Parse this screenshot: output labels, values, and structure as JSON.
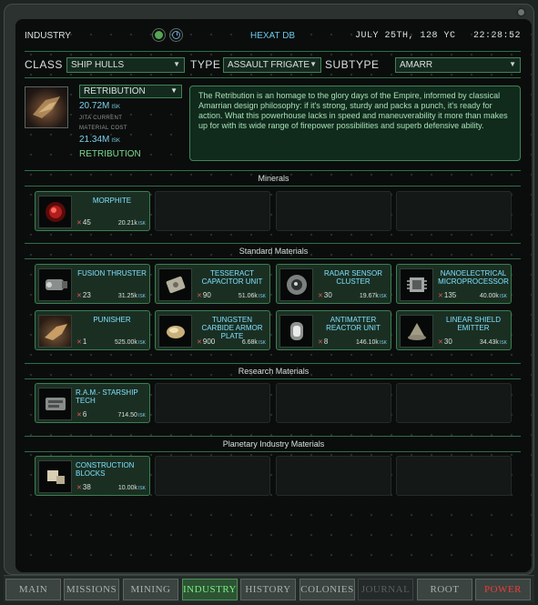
{
  "topbar": {
    "title": "INDUSTRY",
    "center": "HEXAT DB",
    "datetime": "JULY 25TH, 128 YC   22:28:52"
  },
  "filters": {
    "class_label": "CLASS",
    "class_value": "SHIP HULLS",
    "type_label": "TYPE",
    "type_value": "ASSAULT FRIGATE",
    "subtype_label": "SUBTYPE",
    "subtype_value": "AMARR"
  },
  "product": {
    "select_value": "RETRIBUTION",
    "jita_value": "20.72M",
    "jita_unit": "ISK",
    "jita_label": "JITA CURRENT",
    "material_label": "MATERIAL COST",
    "material_value": "21.34M",
    "material_unit": "ISK",
    "name": "RETRIBUTION",
    "description": "The Retribution is an homage to the glory days of the Empire, informed by classical Amarrian design philosophy: if it's strong, sturdy and packs a punch, it's ready for action. What this powerhouse lacks in speed and maneuverability it more than makes up for with its wide range of firepower possibilities and superb defensive ability."
  },
  "sections": {
    "minerals": {
      "title": "Minerals",
      "items": [
        {
          "name": "MORPHITE",
          "qty": "45",
          "price": "20.21k",
          "unit": "ISK",
          "icon": "morphite-icon"
        }
      ]
    },
    "standard": {
      "title": "Standard Materials",
      "items": [
        {
          "name": "FUSION THRUSTER",
          "qty": "23",
          "price": "31.25k",
          "unit": "ISK",
          "icon": "thruster-icon"
        },
        {
          "name": "TESSERACT CAPACITOR UNIT",
          "qty": "90",
          "price": "51.06k",
          "unit": "ISK",
          "icon": "capacitor-icon"
        },
        {
          "name": "RADAR SENSOR CLUSTER",
          "qty": "30",
          "price": "19.67k",
          "unit": "ISK",
          "icon": "sensor-icon"
        },
        {
          "name": "NANOELECTRICAL MICROPROCESSOR",
          "qty": "135",
          "price": "40.00k",
          "unit": "ISK",
          "icon": "microprocessor-icon"
        },
        {
          "name": "PUNISHER",
          "qty": "1",
          "price": "525.00k",
          "unit": "ISK",
          "icon": "punisher-icon"
        },
        {
          "name": "TUNGSTEN CARBIDE ARMOR PLATE",
          "qty": "900",
          "price": "6.68k",
          "unit": "ISK",
          "icon": "armor-plate-icon"
        },
        {
          "name": "ANTIMATTER REACTOR UNIT",
          "qty": "8",
          "price": "146.10k",
          "unit": "ISK",
          "icon": "reactor-icon"
        },
        {
          "name": "LINEAR SHIELD EMITTER",
          "qty": "30",
          "price": "34.43k",
          "unit": "ISK",
          "icon": "shield-emitter-icon"
        }
      ]
    },
    "research": {
      "title": "Research Materials",
      "items": [
        {
          "name": "R.A.M.- STARSHIP TECH",
          "qty": "6",
          "price": "714.50",
          "unit": "ISK",
          "icon": "ram-tech-icon"
        }
      ]
    },
    "planetary": {
      "title": "Planetary Industry Materials",
      "items": [
        {
          "name": "CONSTRUCTION BLOCKS",
          "qty": "38",
          "price": "10.00k",
          "unit": "ISK",
          "icon": "construction-blocks-icon"
        }
      ]
    }
  },
  "nav": [
    "MAIN",
    "MISSIONS",
    "MINING",
    "INDUSTRY",
    "HISTORY",
    "COLONIES",
    "JOURNAL",
    "ROOT",
    "POWER"
  ],
  "colors": {
    "accent": "#3c7e52",
    "active_tab": "#7eea84",
    "power": "#ef3b3b",
    "cyan": "#7fe0ff"
  }
}
